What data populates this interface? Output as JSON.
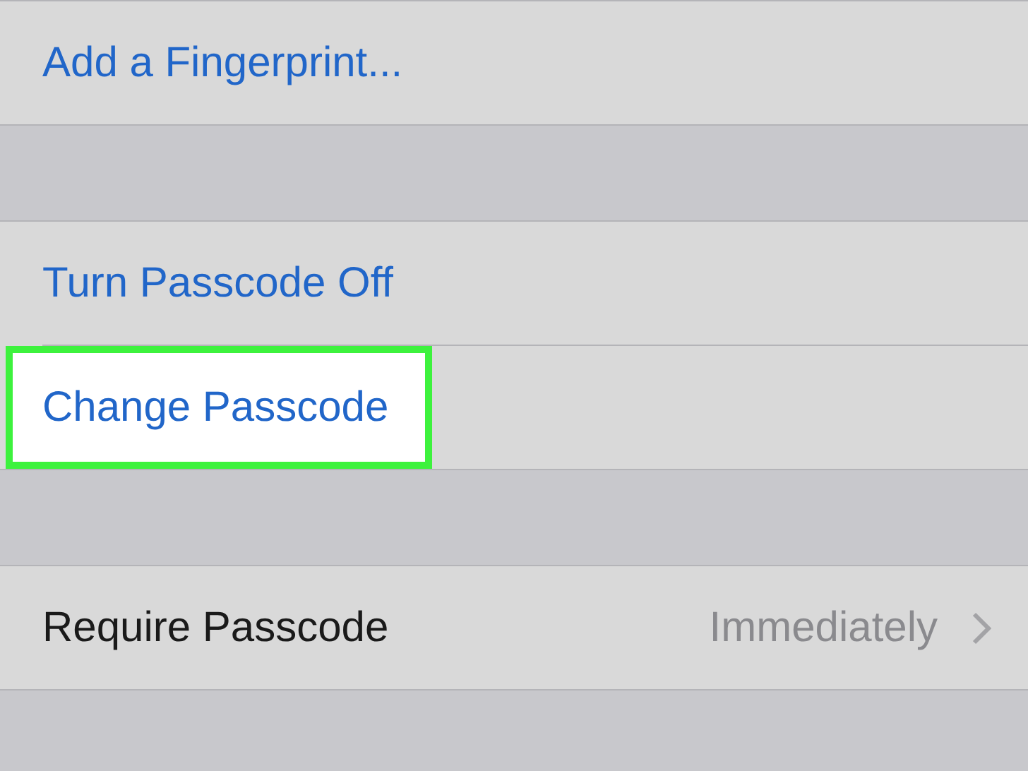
{
  "groups": [
    {
      "rows": [
        {
          "kind": "action",
          "label": "Add a Fingerprint...",
          "highlighted": false
        }
      ]
    },
    {
      "rows": [
        {
          "kind": "action",
          "label": "Turn Passcode Off",
          "highlighted": false
        },
        {
          "kind": "action",
          "label": "Change Passcode",
          "highlighted": true
        }
      ]
    },
    {
      "rows": [
        {
          "kind": "value",
          "label": "Require Passcode",
          "value": "Immediately",
          "highlighted": false
        }
      ]
    }
  ]
}
